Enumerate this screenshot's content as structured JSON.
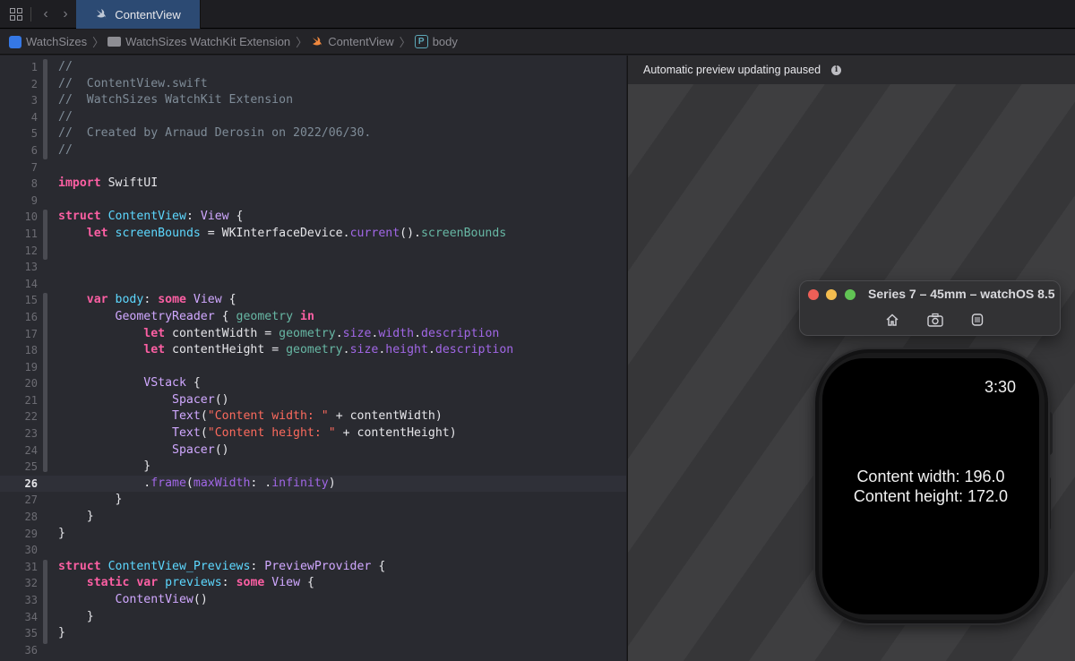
{
  "tabbar": {
    "active_tab": "ContentView"
  },
  "breadcrumbs": [
    {
      "label": "WatchSizes",
      "icon": "app-icon"
    },
    {
      "label": "WatchSizes WatchKit Extension",
      "icon": "folder-icon"
    },
    {
      "label": "ContentView",
      "icon": "swift-icon"
    },
    {
      "label": "body",
      "icon": "property-icon",
      "badge": "P"
    }
  ],
  "editor": {
    "current_line": 26,
    "lines": [
      {
        "n": "1",
        "tokens": [
          [
            "c-com",
            "//"
          ]
        ]
      },
      {
        "n": "2",
        "tokens": [
          [
            "c-com",
            "//  ContentView.swift"
          ]
        ]
      },
      {
        "n": "3",
        "tokens": [
          [
            "c-com",
            "//  WatchSizes WatchKit Extension"
          ]
        ]
      },
      {
        "n": "4",
        "tokens": [
          [
            "c-com",
            "//"
          ]
        ]
      },
      {
        "n": "5",
        "tokens": [
          [
            "c-com",
            "//  Created by Arnaud Derosin on 2022/06/30."
          ]
        ]
      },
      {
        "n": "6",
        "tokens": [
          [
            "c-com",
            "//"
          ]
        ]
      },
      {
        "n": "7",
        "tokens": []
      },
      {
        "n": "8",
        "tokens": [
          [
            "c-kw",
            "import"
          ],
          [
            "",
            " SwiftUI"
          ]
        ]
      },
      {
        "n": "9",
        "tokens": []
      },
      {
        "n": "10",
        "tokens": [
          [
            "c-kw",
            "struct"
          ],
          [
            "",
            " "
          ],
          [
            "c-decl",
            "ContentView"
          ],
          [
            "",
            ": "
          ],
          [
            "c-type",
            "View"
          ],
          [
            "",
            " {"
          ]
        ]
      },
      {
        "n": "11",
        "tokens": [
          [
            "",
            "    "
          ],
          [
            "c-kw",
            "let"
          ],
          [
            "",
            " "
          ],
          [
            "c-decl",
            "screenBounds"
          ],
          [
            "",
            " = WKInterfaceDevice."
          ],
          [
            "c-prop",
            "current"
          ],
          [
            "",
            "()."
          ],
          [
            "c-var",
            "screenBounds"
          ]
        ]
      },
      {
        "n": "12",
        "tokens": []
      },
      {
        "n": "13",
        "tokens": []
      },
      {
        "n": "14",
        "tokens": []
      },
      {
        "n": "15",
        "tokens": [
          [
            "",
            "    "
          ],
          [
            "c-kw",
            "var"
          ],
          [
            "",
            " "
          ],
          [
            "c-decl",
            "body"
          ],
          [
            "",
            ": "
          ],
          [
            "c-kw",
            "some"
          ],
          [
            "",
            " "
          ],
          [
            "c-type",
            "View"
          ],
          [
            "",
            " {"
          ]
        ]
      },
      {
        "n": "16",
        "tokens": [
          [
            "",
            "        "
          ],
          [
            "c-type",
            "GeometryReader"
          ],
          [
            "",
            " { "
          ],
          [
            "c-var",
            "geometry"
          ],
          [
            "",
            " "
          ],
          [
            "c-kw",
            "in"
          ]
        ]
      },
      {
        "n": "17",
        "tokens": [
          [
            "",
            "            "
          ],
          [
            "c-kw",
            "let"
          ],
          [
            "",
            " contentWidth = "
          ],
          [
            "c-var",
            "geometry"
          ],
          [
            "",
            "."
          ],
          [
            "c-prop",
            "size"
          ],
          [
            "",
            "."
          ],
          [
            "c-prop",
            "width"
          ],
          [
            "",
            "."
          ],
          [
            "c-prop",
            "description"
          ]
        ]
      },
      {
        "n": "18",
        "tokens": [
          [
            "",
            "            "
          ],
          [
            "c-kw",
            "let"
          ],
          [
            "",
            " contentHeight = "
          ],
          [
            "c-var",
            "geometry"
          ],
          [
            "",
            "."
          ],
          [
            "c-prop",
            "size"
          ],
          [
            "",
            "."
          ],
          [
            "c-prop",
            "height"
          ],
          [
            "",
            "."
          ],
          [
            "c-prop",
            "description"
          ]
        ]
      },
      {
        "n": "19",
        "tokens": []
      },
      {
        "n": "20",
        "tokens": [
          [
            "",
            "            "
          ],
          [
            "c-type",
            "VStack"
          ],
          [
            "",
            " {"
          ]
        ]
      },
      {
        "n": "21",
        "tokens": [
          [
            "",
            "                "
          ],
          [
            "c-type",
            "Spacer"
          ],
          [
            "",
            "()"
          ]
        ]
      },
      {
        "n": "22",
        "tokens": [
          [
            "",
            "                "
          ],
          [
            "c-type",
            "Text"
          ],
          [
            "",
            "("
          ],
          [
            "c-str",
            "\"Content width: \""
          ],
          [
            "",
            " + contentWidth)"
          ]
        ]
      },
      {
        "n": "23",
        "tokens": [
          [
            "",
            "                "
          ],
          [
            "c-type",
            "Text"
          ],
          [
            "",
            "("
          ],
          [
            "c-str",
            "\"Content height: \""
          ],
          [
            "",
            " + contentHeight)"
          ]
        ]
      },
      {
        "n": "24",
        "tokens": [
          [
            "",
            "                "
          ],
          [
            "c-type",
            "Spacer"
          ],
          [
            "",
            "()"
          ]
        ]
      },
      {
        "n": "25",
        "tokens": [
          [
            "",
            "            }"
          ]
        ]
      },
      {
        "n": "26",
        "tokens": [
          [
            "",
            "            ."
          ],
          [
            "c-prop",
            "frame"
          ],
          [
            "",
            "("
          ],
          [
            "c-prop",
            "maxWidth"
          ],
          [
            "",
            ": ."
          ],
          [
            "c-prop",
            "infinity"
          ],
          [
            "",
            ")"
          ]
        ]
      },
      {
        "n": "27",
        "tokens": [
          [
            "",
            "        }"
          ]
        ]
      },
      {
        "n": "28",
        "tokens": [
          [
            "",
            "    }"
          ]
        ]
      },
      {
        "n": "29",
        "tokens": [
          [
            "",
            "}"
          ]
        ]
      },
      {
        "n": "30",
        "tokens": []
      },
      {
        "n": "31",
        "tokens": [
          [
            "c-kw",
            "struct"
          ],
          [
            "",
            " "
          ],
          [
            "c-decl",
            "ContentView_Previews"
          ],
          [
            "",
            ": "
          ],
          [
            "c-type",
            "PreviewProvider"
          ],
          [
            "",
            " {"
          ]
        ]
      },
      {
        "n": "32",
        "tokens": [
          [
            "",
            "    "
          ],
          [
            "c-kw",
            "static"
          ],
          [
            "",
            " "
          ],
          [
            "c-kw",
            "var"
          ],
          [
            "",
            " "
          ],
          [
            "c-decl",
            "previews"
          ],
          [
            "",
            ": "
          ],
          [
            "c-kw",
            "some"
          ],
          [
            "",
            " "
          ],
          [
            "c-type",
            "View"
          ],
          [
            "",
            " {"
          ]
        ]
      },
      {
        "n": "33",
        "tokens": [
          [
            "",
            "        "
          ],
          [
            "c-type",
            "ContentView"
          ],
          [
            "",
            "()"
          ]
        ]
      },
      {
        "n": "34",
        "tokens": [
          [
            "",
            "    }"
          ]
        ]
      },
      {
        "n": "35",
        "tokens": [
          [
            "",
            "}"
          ]
        ]
      },
      {
        "n": "36",
        "tokens": []
      }
    ]
  },
  "preview": {
    "status": "Automatic preview updating paused",
    "simulator_title": "Series 7 – 45mm – watchOS 8.5",
    "watch": {
      "time": "3:30",
      "width_text": "Content width: 196.0",
      "height_text": "Content height: 172.0"
    }
  }
}
